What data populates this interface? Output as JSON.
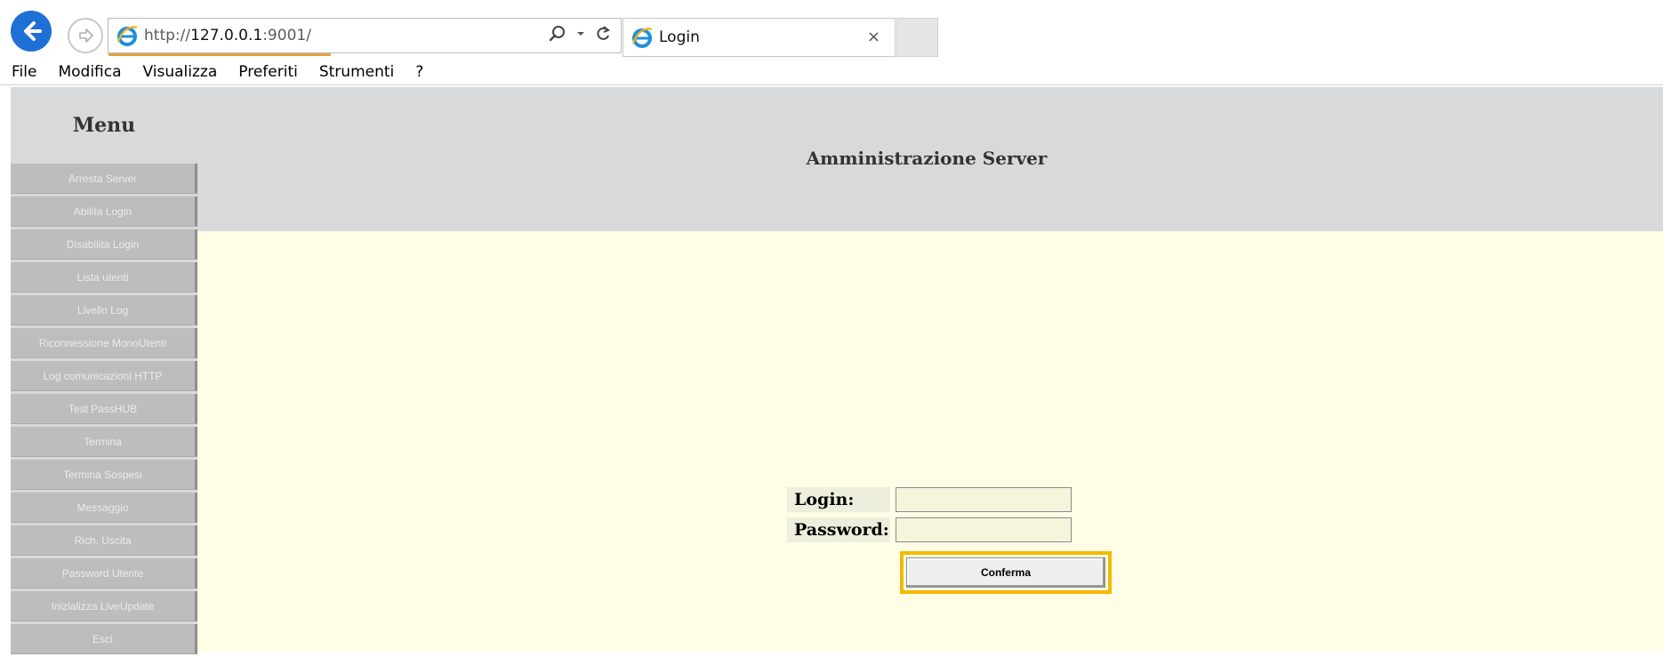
{
  "browser": {
    "url_scheme": "http://",
    "url_host": "127.0.0.1",
    "url_rest": ":9001/",
    "tab_title": "Login",
    "tab_close": "×"
  },
  "menubar": {
    "items": [
      "File",
      "Modifica",
      "Visualizza",
      "Preferiti",
      "Strumenti",
      "?"
    ]
  },
  "sidebar": {
    "title": "Menu",
    "items": [
      "Arresta Server",
      "Abilita Login",
      "Disabilita Login",
      "Lista utenti",
      "Livello Log",
      "Riconnessione MonoUtenti",
      "Log comunicazioni HTTP",
      "Test PassHUB",
      "Termina",
      "Termina Sospesi",
      "Messaggio",
      "Rich. Uscita",
      "Password Utente",
      "Inizializza LiveUpdate",
      "Esci"
    ]
  },
  "main": {
    "title": "Amministrazione Server"
  },
  "login": {
    "login_label": "Login:",
    "password_label": "Password:",
    "login_value": "",
    "password_value": "",
    "confirm_label": "Conferma"
  },
  "colors": {
    "header_bg": "#d8d9db",
    "content_bg": "#fffde6",
    "button_highlight": "#f5b800",
    "back_button": "#1e6fd6"
  }
}
